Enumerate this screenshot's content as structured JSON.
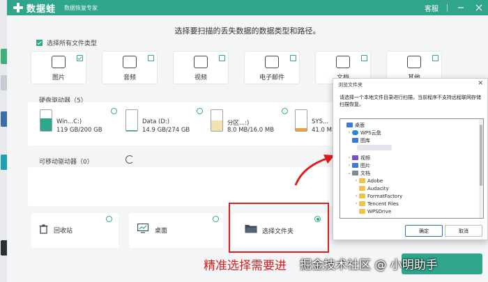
{
  "app": {
    "name": "数据蛙",
    "subtitle": "数据恢复专家",
    "service_label": "客服",
    "minimize_icon": "minimize-icon",
    "close_icon": "close-icon",
    "brand_color": "#2fa58b"
  },
  "headline": "选择要扫描的丢失数据的数据类型和路径。",
  "select_all_label": "选择所有文件类型",
  "file_types": [
    {
      "label": "图片",
      "icon": "image-icon",
      "checked": true
    },
    {
      "label": "音频",
      "icon": "music-icon",
      "checked": false
    },
    {
      "label": "视频",
      "icon": "film-icon",
      "checked": false
    },
    {
      "label": "电子邮件",
      "icon": "mail-icon",
      "checked": false
    },
    {
      "label": "文档",
      "icon": "document-icon",
      "checked": false
    },
    {
      "label": "其他",
      "icon": "grid-icon",
      "checked": false
    }
  ],
  "hard_drives": {
    "title": "硬盘驱动器（5）",
    "drives": [
      {
        "name": "Win...C:)",
        "size": "119 GB/200 GB",
        "fill": 0.6,
        "color": "#2fa58b"
      },
      {
        "name": "Data (D:)",
        "size": "14.9 GB/274 GB",
        "fill": 0.05,
        "color": "#2fa58b"
      },
      {
        "name": "分区...:)",
        "size": "8.0 MB/16.0 MB",
        "fill": 0.5,
        "color": "#f2e2b0"
      },
      {
        "name": "SYS...",
        "size": "41.0 MB",
        "fill": 0.15,
        "color": "#f2a13c"
      }
    ]
  },
  "removable_drives": {
    "title": "可移动驱动器（0）"
  },
  "locations": [
    {
      "label": "回收站",
      "icon": "recycle-bin-icon",
      "selected": false
    },
    {
      "label": "桌面",
      "icon": "desktop-icon",
      "selected": false
    },
    {
      "label": "选择文件夹",
      "icon": "folder-icon",
      "selected": true
    }
  ],
  "caption": "精准选择需要进",
  "watermark": "掘金技术社区 @ 小明助手",
  "dialog": {
    "title": "浏览文件夹",
    "description": "请选择一个本地文件目录进行扫描，当前程序不支持远程联网存储扫描恢复。",
    "tree": [
      {
        "label": "桌面",
        "depth": 0,
        "expand": "",
        "icon_color": "#3b7bd6"
      },
      {
        "label": "WPS云盘",
        "depth": 1,
        "expand": "›",
        "icon_color": "#1e88e5"
      },
      {
        "label": "图库",
        "depth": 1,
        "expand": "",
        "icon_color": "#3b7bd6"
      },
      {
        "label": "视频",
        "depth": 1,
        "expand": "›",
        "icon_color": "#7b4bd6"
      },
      {
        "label": "图片",
        "depth": 1,
        "expand": "›",
        "icon_color": "#3b7bd6"
      },
      {
        "label": "文档",
        "depth": 1,
        "expand": "⌄",
        "icon_color": "#7d8a96"
      },
      {
        "label": "Adobe",
        "depth": 2,
        "expand": "›",
        "icon_color": "#f2c14e"
      },
      {
        "label": "Audacity",
        "depth": 2,
        "expand": "",
        "icon_color": "#f2c14e"
      },
      {
        "label": "FormatFactory",
        "depth": 2,
        "expand": "›",
        "icon_color": "#f2c14e"
      },
      {
        "label": "Tencent Files",
        "depth": 2,
        "expand": "›",
        "icon_color": "#f2c14e"
      },
      {
        "label": "WPSDrive",
        "depth": 2,
        "expand": "",
        "icon_color": "#f2c14e"
      }
    ],
    "ok_label": "确定",
    "cancel_label": "取消"
  }
}
